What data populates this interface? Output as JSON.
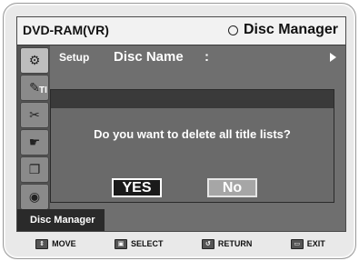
{
  "header": {
    "mode_label": "DVD-RAM(VR)",
    "menu_title": "Disc Manager"
  },
  "setup_row": {
    "setup_label": "Setup",
    "disc_name_label": "Disc Name",
    "colon": ":"
  },
  "sidebar": {
    "partial_label": "TI",
    "active_tab_label": "Disc Manager"
  },
  "dialog": {
    "question": "Do you want to delete all title lists?",
    "yes_label": "YES",
    "no_label": "No"
  },
  "hints": [
    {
      "icon": "move-icon",
      "label": "MOVE"
    },
    {
      "icon": "select-icon",
      "label": "SELECT"
    },
    {
      "icon": "return-icon",
      "label": "RETURN"
    },
    {
      "icon": "exit-icon",
      "label": "EXIT"
    }
  ]
}
